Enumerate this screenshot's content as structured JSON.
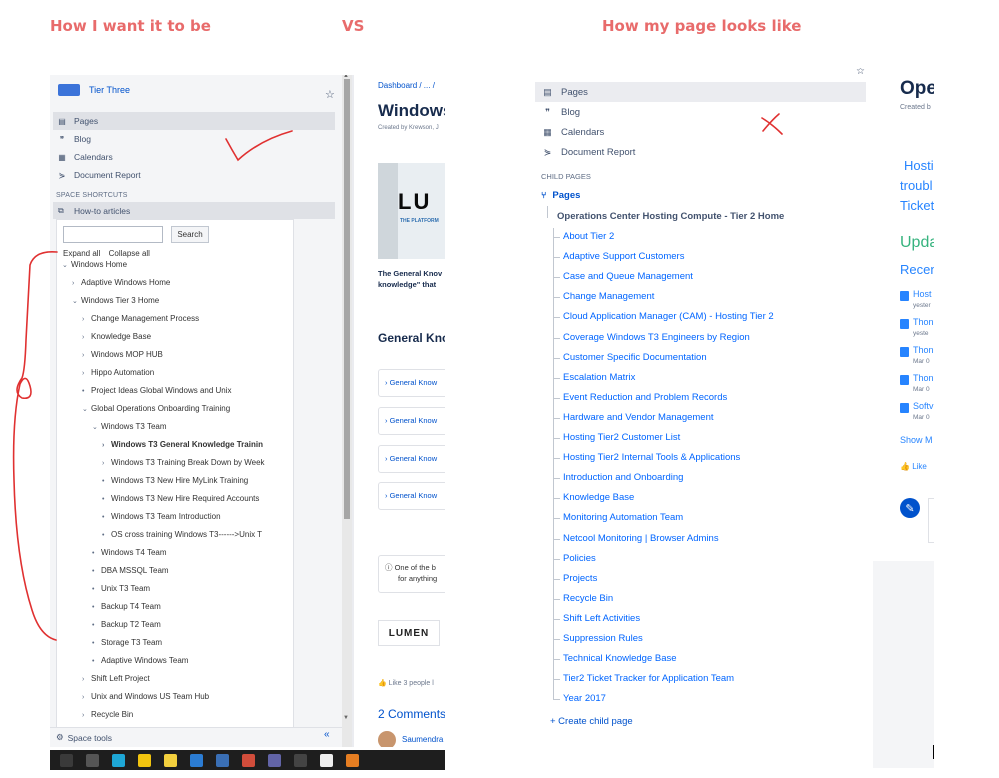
{
  "captions": {
    "left": "How I want it to be",
    "vs": "VS",
    "right": "How my page looks like"
  },
  "colors": {
    "caption": "#e86b6b",
    "link": "#0052cc",
    "sidebar_bg": "#f4f5f7",
    "annotation": "#e03131"
  },
  "left": {
    "space_name": "Tier Three",
    "nav": [
      {
        "label": "Pages",
        "icon": "page-icon"
      },
      {
        "label": "Blog",
        "icon": "quote-icon"
      },
      {
        "label": "Calendars",
        "icon": "calendar-icon"
      },
      {
        "label": "Document Report",
        "icon": "report-icon"
      }
    ],
    "shortcuts_heading": "SPACE SHORTCUTS",
    "howto": "How-to articles",
    "search_button": "Search",
    "expand_all": "Expand all",
    "collapse_all": "Collapse all",
    "tree": [
      {
        "label": "Windows Home",
        "marker": "⌄",
        "level": 0
      },
      {
        "label": "Adaptive Windows Home",
        "marker": "›",
        "level": 1
      },
      {
        "label": "Windows Tier 3 Home",
        "marker": "⌄",
        "level": 1
      },
      {
        "label": "Change Management Process",
        "marker": "›",
        "level": 2
      },
      {
        "label": "Knowledge Base",
        "marker": "›",
        "level": 2
      },
      {
        "label": "Windows MOP HUB",
        "marker": "›",
        "level": 2
      },
      {
        "label": "Hippo Automation",
        "marker": "›",
        "level": 2
      },
      {
        "label": "Project Ideas Global Windows and Unix",
        "marker": "•",
        "level": 2
      },
      {
        "label": "Global Operations Onboarding Training",
        "marker": "⌄",
        "level": 2
      },
      {
        "label": "Windows T3 Team",
        "marker": "⌄",
        "level": 3
      },
      {
        "label": "Windows T3 General Knowledge Trainin",
        "marker": "›",
        "level": 4,
        "bold": true
      },
      {
        "label": "Windows T3 Training Break Down by Week",
        "marker": "›",
        "level": 4
      },
      {
        "label": "Windows T3 New Hire MyLink Training",
        "marker": "•",
        "level": 4
      },
      {
        "label": "Windows T3 New Hire Required Accounts",
        "marker": "•",
        "level": 4
      },
      {
        "label": "Windows T3 Team Introduction",
        "marker": "•",
        "level": 4
      },
      {
        "label": "OS cross training Windows T3------>Unix T",
        "marker": "•",
        "level": 4
      },
      {
        "label": "Windows T4 Team",
        "marker": "•",
        "level": 3
      },
      {
        "label": "DBA MSSQL Team",
        "marker": "•",
        "level": 3
      },
      {
        "label": "Unix T3 Team",
        "marker": "•",
        "level": 3
      },
      {
        "label": "Backup T4 Team",
        "marker": "•",
        "level": 3
      },
      {
        "label": "Backup T2 Team",
        "marker": "•",
        "level": 3
      },
      {
        "label": "Storage T3 Team",
        "marker": "•",
        "level": 3
      },
      {
        "label": "Adaptive Windows Team",
        "marker": "•",
        "level": 3
      },
      {
        "label": "Shift Left Project",
        "marker": "›",
        "level": 2
      },
      {
        "label": "Unix and Windows US Team Hub",
        "marker": "›",
        "level": 2
      },
      {
        "label": "Recycle Bin",
        "marker": "›",
        "level": 2
      }
    ],
    "space_tools": "Space tools",
    "content": {
      "breadcrumb": "Dashboard / ... /",
      "title": "Windows",
      "created_by": "Created by Krewson, J",
      "banner_text": "LU",
      "banner_tag": "THE PLATFORM",
      "intro_line1": "The General Knov",
      "intro_line2": "knowledge\" that",
      "heading": "General Kno",
      "boxes": [
        "› General Know",
        "› General Know",
        "› General Know",
        "› General Know"
      ],
      "info_line1": "One of the b",
      "info_line2": "for anything",
      "logo": "LUMEN",
      "like": "Like   3 people l",
      "comments": "2 Comments",
      "commenter": "Saumendra"
    }
  },
  "right": {
    "nav": [
      {
        "label": "Pages",
        "icon": "page-icon"
      },
      {
        "label": "Blog",
        "icon": "quote-icon"
      },
      {
        "label": "Calendars",
        "icon": "calendar-icon"
      },
      {
        "label": "Document Report",
        "icon": "report-icon"
      }
    ],
    "child_pages_heading": "CHILD PAGES",
    "pages_label": "Pages",
    "root_page": "Operations Center Hosting Compute - Tier 2 Home",
    "children": [
      "About Tier 2",
      "Adaptive Support Customers",
      "Case and Queue Management",
      "Change Management",
      "Cloud Application Manager (CAM) - Hosting Tier 2",
      "Coverage Windows T3 Engineers by Region",
      "Customer Specific Documentation",
      "Escalation Matrix",
      "Event Reduction and Problem Records",
      "Hardware and Vendor Management",
      "Hosting Tier2 Customer List",
      "Hosting Tier2 Internal Tools & Applications",
      "Introduction and Onboarding",
      "Knowledge Base",
      "Monitoring Automation Team",
      "Netcool Monitoring | Browser Admins",
      "Policies",
      "Projects",
      "Recycle Bin",
      "Shift Left Activities",
      "Suppression Rules",
      "Technical Knowledge Base",
      "Tier2 Ticket Tracker for Application Team",
      "Year 2017"
    ],
    "create_child": "+ Create child page",
    "content": {
      "title": "Ope",
      "created_by": "Created b",
      "hosting_lines": [
        "Hosti",
        "troubl",
        "Ticket"
      ],
      "updates": "Upda",
      "recent": "Recen",
      "recent_items": [
        {
          "title": "Host",
          "date": "yester"
        },
        {
          "title": "Thon",
          "date": "yeste"
        },
        {
          "title": "Thon",
          "date": "Mar 0"
        },
        {
          "title": "Thon",
          "date": "Mar 0"
        },
        {
          "title": "Softv",
          "date": "Mar 0"
        }
      ],
      "show_more": "Show M",
      "like": "Like"
    }
  }
}
